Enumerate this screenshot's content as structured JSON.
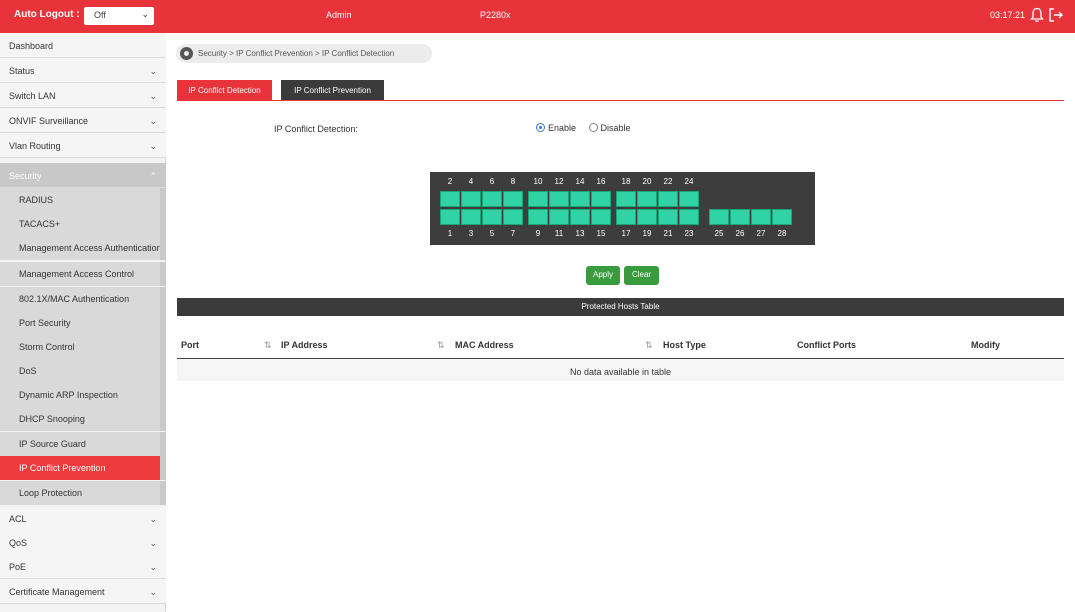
{
  "topbar": {
    "auto_logout_label": "Auto Logout :",
    "auto_logout_value": "Off",
    "user": "Admin",
    "model": "P2280x",
    "time": "03:17:21"
  },
  "sidebar": {
    "items": [
      {
        "label": "Dashboard"
      },
      {
        "label": "Status"
      },
      {
        "label": "Switch LAN"
      },
      {
        "label": "ONVIF Surveillance"
      },
      {
        "label": "Vlan Routing"
      },
      {
        "label": "Security"
      },
      {
        "label": "ACL"
      },
      {
        "label": "QoS"
      },
      {
        "label": "PoE"
      },
      {
        "label": "Certificate Management"
      }
    ],
    "security_sub": [
      "RADIUS",
      "TACACS+",
      "Management Access Authentication",
      "Management Access Control",
      "802.1X/MAC Authentication",
      "Port Security",
      "Storm Control",
      "DoS",
      "Dynamic ARP Inspection",
      "DHCP Snooping",
      "IP Source Guard",
      "IP Conflict Prevention",
      "Loop Protection"
    ]
  },
  "breadcrumb": "Security > IP Conflict Prevention > IP Conflict Detection",
  "tabs": [
    "IP Conflict Detection",
    "IP Conflict Prevention"
  ],
  "form": {
    "label": "IP Conflict Detection:",
    "enable_label": "Enable",
    "disable_label": "Disable",
    "selected": "Enable"
  },
  "ports": {
    "top_row": [
      "2",
      "4",
      "6",
      "8",
      "10",
      "12",
      "14",
      "16",
      "18",
      "20",
      "22",
      "24"
    ],
    "bottom_row": [
      "1",
      "3",
      "5",
      "7",
      "9",
      "11",
      "13",
      "15",
      "17",
      "19",
      "21",
      "23",
      "25",
      "26",
      "27",
      "28"
    ]
  },
  "buttons": {
    "apply": "Apply",
    "clear": "Clear"
  },
  "table": {
    "title": "Protected Hosts Table",
    "columns": [
      "Port",
      "IP Address",
      "MAC Address",
      "Host Type",
      "Conflict Ports",
      "Modify"
    ],
    "empty_message": "No data available in table"
  },
  "colors": {
    "brand_red": "#e8333a",
    "dark_bar": "#3b3b3b",
    "port_green": "#2fd3a4",
    "button_green": "#3a9a3e"
  }
}
